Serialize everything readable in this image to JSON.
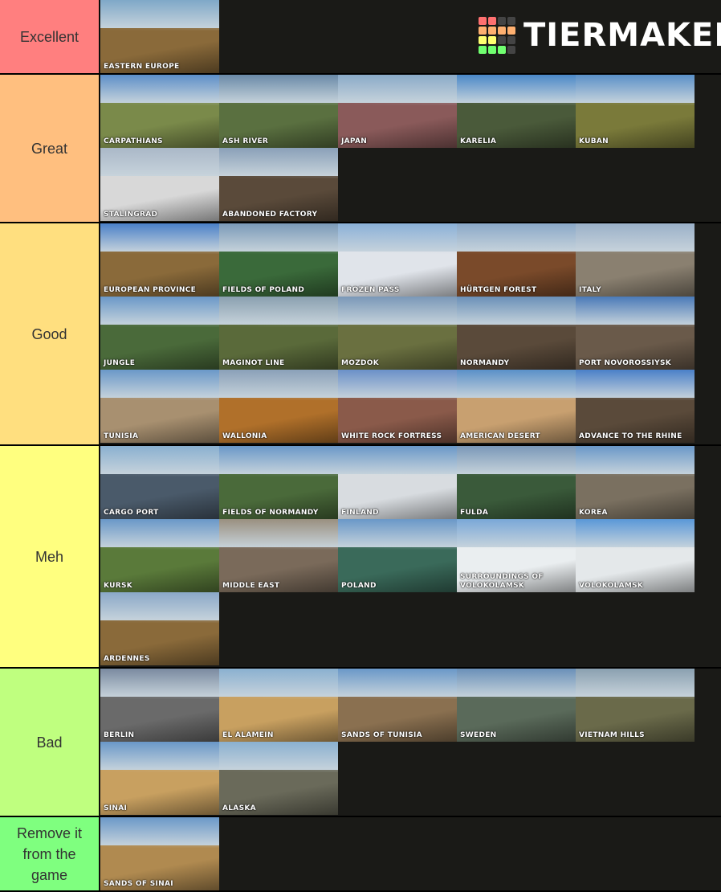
{
  "logo": {
    "text": "TIERMAKER",
    "grid": [
      "#ff7070",
      "#ff7070",
      "#444444",
      "#444444",
      "#ffb070",
      "#ffb070",
      "#ffb070",
      "#ffb070",
      "#ffff70",
      "#ffff70",
      "#444444",
      "#444444",
      "#70ff70",
      "#70ff70",
      "#70ff70",
      "#444444"
    ]
  },
  "tiers": [
    {
      "label": "Excellent",
      "color": "#ff7f7f",
      "items": [
        {
          "name": "Eastern Europe",
          "sky": "#7fa8c8",
          "ground": "#8a6a3a"
        }
      ]
    },
    {
      "label": "Great",
      "color": "#ffbf7f",
      "items": [
        {
          "name": "Carpathians",
          "sky": "#5d8fc8",
          "ground": "#7a8a4a"
        },
        {
          "name": "Ash River",
          "sky": "#6a8aa8",
          "ground": "#5a7040"
        },
        {
          "name": "Japan",
          "sky": "#8aaac8",
          "ground": "#8a5a5a"
        },
        {
          "name": "Karelia",
          "sky": "#4a88c8",
          "ground": "#4a5a3a"
        },
        {
          "name": "Kuban",
          "sky": "#5a90c8",
          "ground": "#7a7a3a"
        },
        {
          "name": "Stalingrad",
          "sky": "#aab8c8",
          "ground": "#d8d8d8"
        },
        {
          "name": "Abandoned Factory",
          "sky": "#8aa0b8",
          "ground": "#5a4a3a"
        }
      ]
    },
    {
      "label": "Good",
      "color": "#ffdf7f",
      "items": [
        {
          "name": "European Province",
          "sky": "#4a80c8",
          "ground": "#8a6a3a"
        },
        {
          "name": "Fields of Poland",
          "sky": "#7a9ab8",
          "ground": "#3a6a3a"
        },
        {
          "name": "Frozen Pass",
          "sky": "#8ab0d8",
          "ground": "#e0e4ea"
        },
        {
          "name": "Hürtgen Forest",
          "sky": "#8aa8c8",
          "ground": "#7a4a2a"
        },
        {
          "name": "Italy",
          "sky": "#9ab0c8",
          "ground": "#8a8070"
        },
        {
          "name": "Jungle",
          "sky": "#6a98c8",
          "ground": "#4a6a3a"
        },
        {
          "name": "Maginot Line",
          "sky": "#8aa0b0",
          "ground": "#5a6a3a"
        },
        {
          "name": "Mozdok",
          "sky": "#7a98b8",
          "ground": "#6a7040"
        },
        {
          "name": "Normandy",
          "sky": "#6a90b8",
          "ground": "#5a4a3a"
        },
        {
          "name": "Port Novorossiysk",
          "sky": "#4a7ab8",
          "ground": "#6a5a4a"
        },
        {
          "name": "Tunisia",
          "sky": "#6a98c8",
          "ground": "#a89070"
        },
        {
          "name": "Wallonia",
          "sky": "#8aa0b8",
          "ground": "#b0702a"
        },
        {
          "name": "White Rock Fortress",
          "sky": "#6a90c8",
          "ground": "#8a5a4a"
        },
        {
          "name": "American Desert",
          "sky": "#5a90c8",
          "ground": "#c8a070"
        },
        {
          "name": "Advance to the Rhine",
          "sky": "#4a80c8",
          "ground": "#5a4a3a"
        }
      ]
    },
    {
      "label": "Meh",
      "color": "#ffff7f",
      "items": [
        {
          "name": "Cargo Port",
          "sky": "#8ab0d0",
          "ground": "#4a5a6a"
        },
        {
          "name": "Fields of Normandy",
          "sky": "#6a98c8",
          "ground": "#4a6a3a"
        },
        {
          "name": "Finland",
          "sky": "#6a98c8",
          "ground": "#d8dce0"
        },
        {
          "name": "Fulda",
          "sky": "#7a98b8",
          "ground": "#3a5a3a"
        },
        {
          "name": "Korea",
          "sky": "#6a98c8",
          "ground": "#7a7060"
        },
        {
          "name": "Kursk",
          "sky": "#6a98c8",
          "ground": "#5a7a3a"
        },
        {
          "name": "Middle East",
          "sky": "#9a9080",
          "ground": "#7a6a5a"
        },
        {
          "name": "Poland",
          "sky": "#6a98c8",
          "ground": "#3a6a5a"
        },
        {
          "name": "Surroundings of Volokolamsk",
          "sky": "#7aa8d8",
          "ground": "#eaeef0"
        },
        {
          "name": "Volokolamsk",
          "sky": "#5a98d8",
          "ground": "#e4e8ea"
        },
        {
          "name": "Ardennes",
          "sky": "#8aa8c8",
          "ground": "#8a6a3a"
        }
      ]
    },
    {
      "label": "Bad",
      "color": "#bfff7f",
      "items": [
        {
          "name": "Berlin",
          "sky": "#7a8aa0",
          "ground": "#6a6a6a"
        },
        {
          "name": "El Alamein",
          "sky": "#8ab0d0",
          "ground": "#c8a060"
        },
        {
          "name": "Sands of Tunisia",
          "sky": "#6a98c8",
          "ground": "#8a7050"
        },
        {
          "name": "Sweden",
          "sky": "#6a90b8",
          "ground": "#5a6a5a"
        },
        {
          "name": "Vietnam Hills",
          "sky": "#8aa0b0",
          "ground": "#6a6a4a"
        },
        {
          "name": "Sinai",
          "sky": "#6a98c8",
          "ground": "#c8a060"
        },
        {
          "name": "Alaska",
          "sky": "#8ab0d0",
          "ground": "#6a6a5a"
        }
      ]
    },
    {
      "label": "Remove it from the game",
      "color": "#7fff7f",
      "items": [
        {
          "name": "Sands of Sinai",
          "sky": "#6a98c8",
          "ground": "#b08a50"
        }
      ]
    }
  ]
}
